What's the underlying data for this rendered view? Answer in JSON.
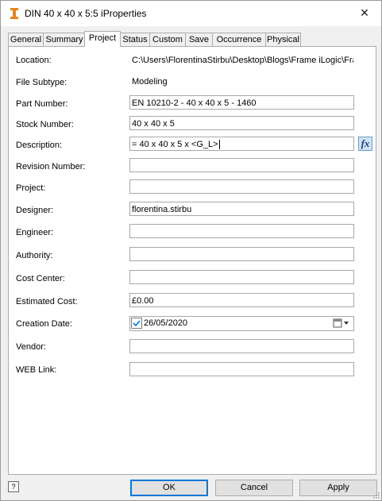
{
  "window": {
    "title": "DIN 40 x 40 x 5:5 iProperties",
    "close_label": "×"
  },
  "tabs": [
    "General",
    "Summary",
    "Project",
    "Status",
    "Custom",
    "Save",
    "Occurrence",
    "Physical"
  ],
  "active_tab": "Project",
  "fields": {
    "location": {
      "label": "Location:",
      "value": "C:\\Users\\FlorentinaStirbu\\Desktop\\Blogs\\Frame iLogic\\Frame-"
    },
    "file_subtype": {
      "label": "File Subtype:",
      "value": "Modeling"
    },
    "part_number": {
      "label": "Part Number:",
      "value": "EN 10210-2 - 40 x 40 x 5 - 1460"
    },
    "stock_number": {
      "label": "Stock Number:",
      "value": "40 x 40 x 5"
    },
    "description": {
      "label": "Description:",
      "value": "= 40 x 40 x 5 x <G_L>"
    },
    "revision_number": {
      "label": "Revision Number:",
      "value": ""
    },
    "project": {
      "label": "Project:",
      "value": ""
    },
    "designer": {
      "label": "Designer:",
      "value": "florentina.stirbu"
    },
    "engineer": {
      "label": "Engineer:",
      "value": ""
    },
    "authority": {
      "label": "Authority:",
      "value": ""
    },
    "cost_center": {
      "label": "Cost Center:",
      "value": ""
    },
    "estimated_cost": {
      "label": "Estimated Cost:",
      "value": "£0.00"
    },
    "creation_date": {
      "label": "Creation Date:",
      "value": "26/05/2020",
      "checked": true
    },
    "vendor": {
      "label": "Vendor:",
      "value": ""
    },
    "web_link": {
      "label": "WEB Link:",
      "value": ""
    }
  },
  "fx_label": "fx",
  "buttons": {
    "ok": "OK",
    "cancel": "Cancel",
    "apply": "Apply",
    "help": "?"
  },
  "colors": {
    "accent": "#0078d7",
    "title_icon": "#e8841a"
  }
}
